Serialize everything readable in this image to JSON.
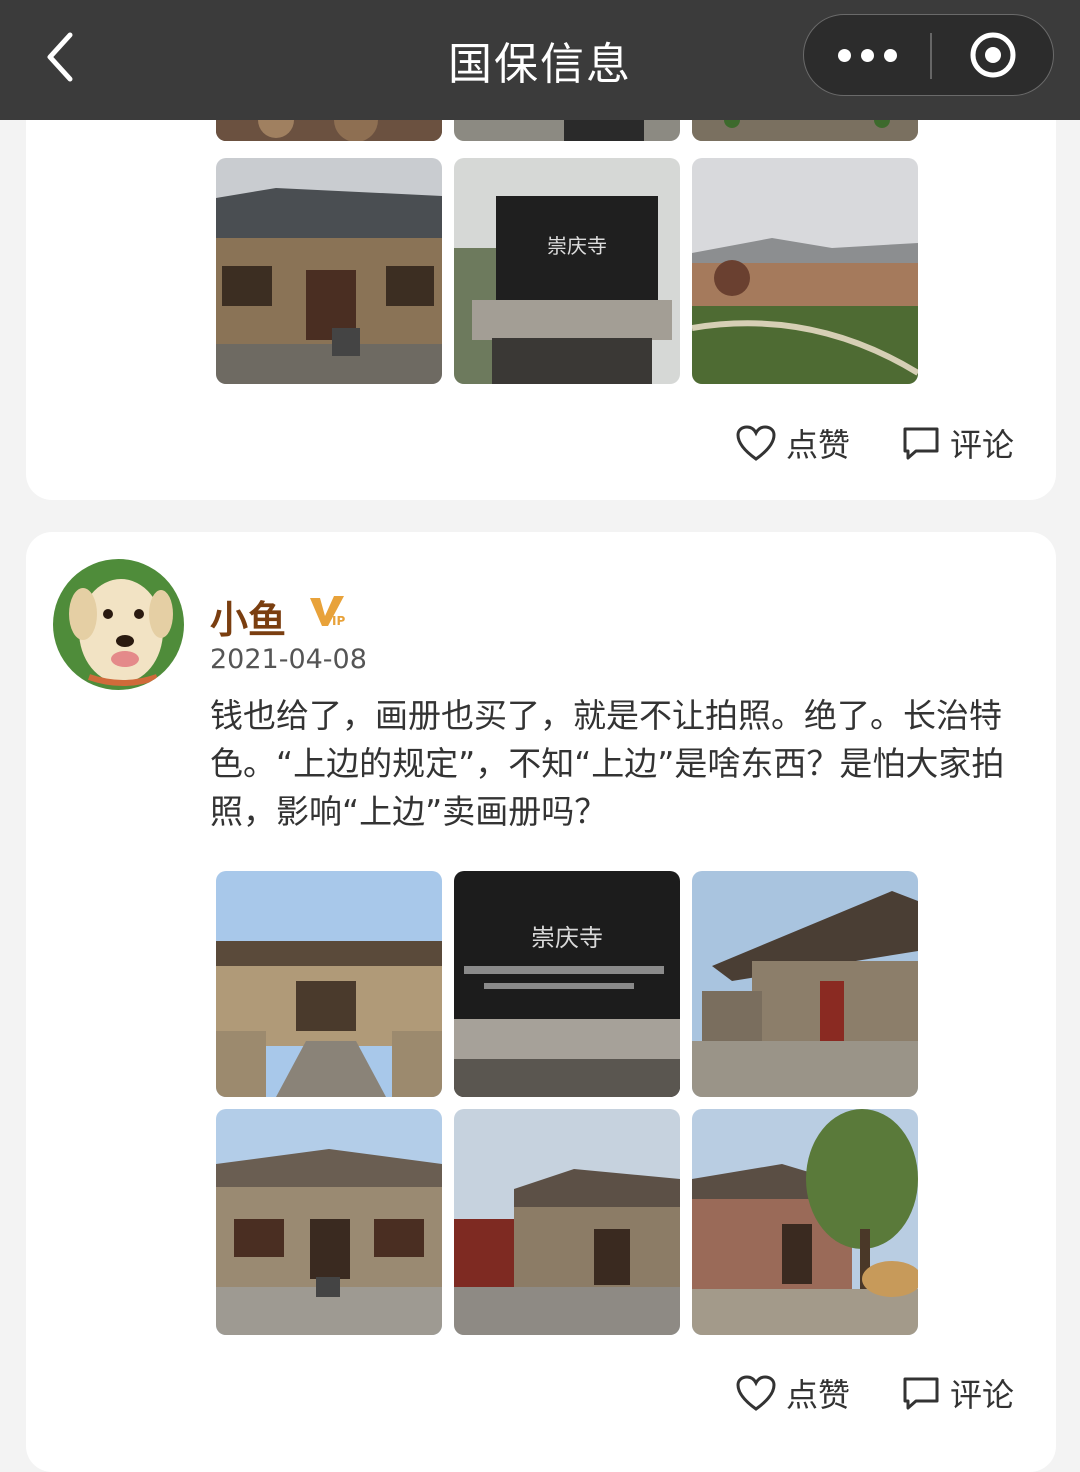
{
  "nav": {
    "title": "国保信息",
    "back_icon": "chevron-left-icon",
    "more_icon": "more-dots-icon",
    "target_icon": "target-circle-icon"
  },
  "post1": {
    "actions": {
      "like_label": "点赞",
      "comment_label": "评论"
    }
  },
  "post2": {
    "username": "小鱼",
    "badge": "VIP",
    "date": "2021-04-08",
    "content": "钱也给了，画册也买了，就是不让拍照。绝了。长治特色。“上边的规定”，不知“上边”是啥东西？是怕大家拍照，影响“上边”卖画册吗？",
    "stele_text": "崇庆寺",
    "actions": {
      "like_label": "点赞",
      "comment_label": "评论"
    }
  },
  "colors": {
    "topbar": "#3b3b3b",
    "username": "#7a3e10",
    "vip_badge": "#e8a23a"
  }
}
